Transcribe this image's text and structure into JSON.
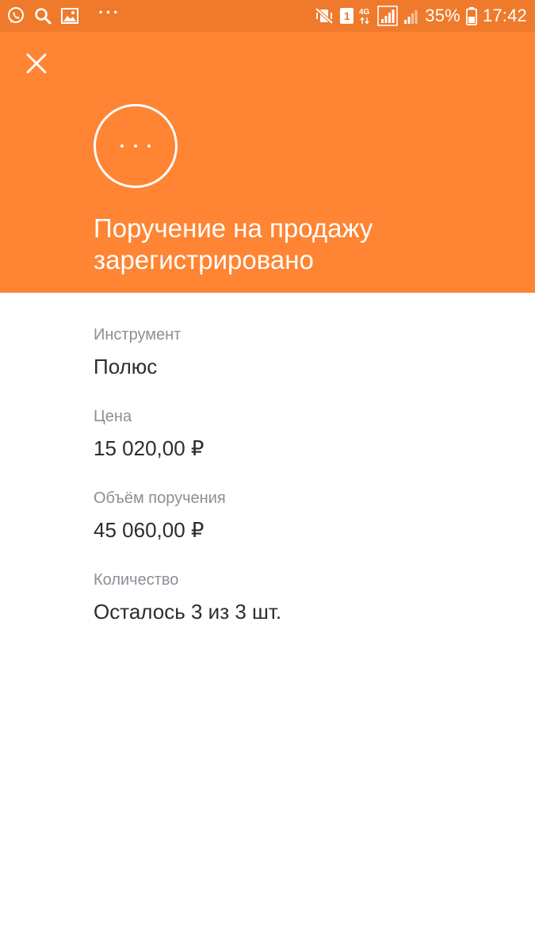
{
  "status_bar": {
    "battery": "35%",
    "time": "17:42",
    "sim_slot": "1",
    "network": "4G",
    "more_indicator": "···",
    "left_icons": [
      "whatsapp-icon",
      "search-icon",
      "gallery-icon"
    ],
    "right_icons": [
      "mute-vibrate-icon",
      "sim-icon",
      "network-4g-icon",
      "signal-icon",
      "signal-icon",
      "battery-icon"
    ]
  },
  "header": {
    "close_icon": "close-icon",
    "status_icon": "pending-dots-icon",
    "title": "Поручение на продажу зарегистрировано"
  },
  "details": [
    {
      "label": "Инструмент",
      "value": "Полюс"
    },
    {
      "label": "Цена",
      "value": "15 020,00 ₽"
    },
    {
      "label": "Объём поручения",
      "value": "45 060,00 ₽"
    },
    {
      "label": "Количество",
      "value": "Осталось 3 из 3 шт."
    }
  ],
  "colors": {
    "status_bar": "#ef7a2c",
    "header": "#ff8433",
    "label": "#8a8f97",
    "value": "#2b2d30"
  }
}
